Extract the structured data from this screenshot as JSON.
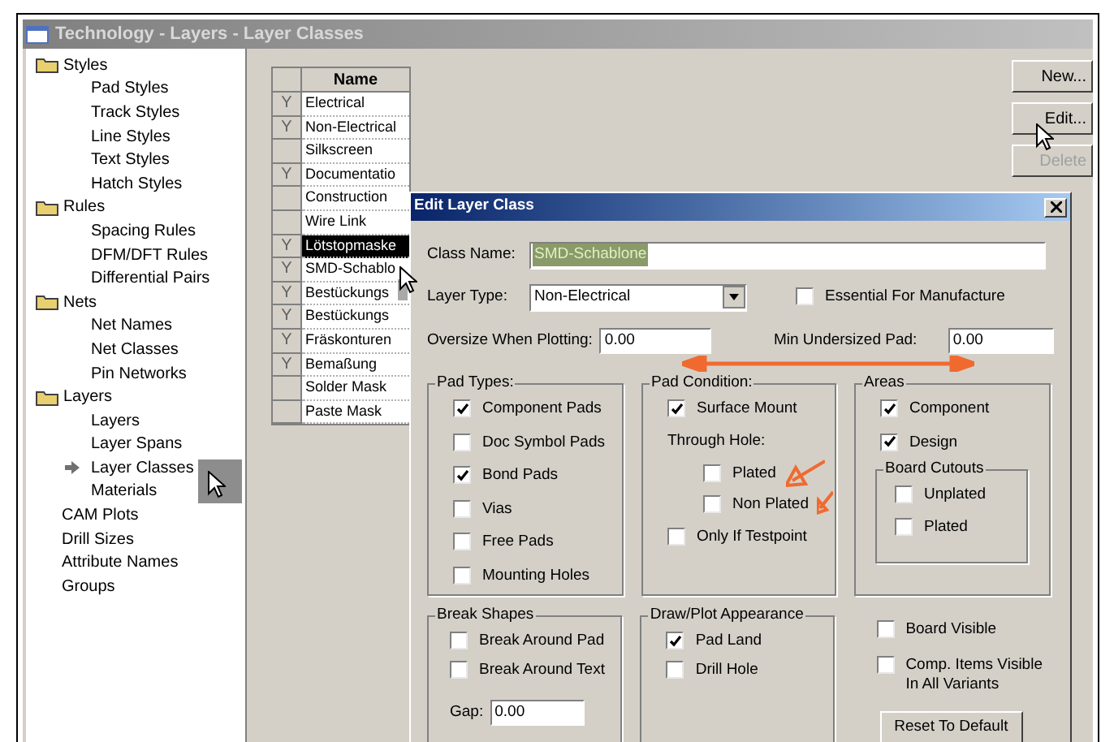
{
  "window": {
    "title": "Technology - Layers - Layer Classes"
  },
  "tree": [
    {
      "label": "Styles",
      "kind": "folder",
      "children": [
        {
          "label": "Pad Styles",
          "current": false
        },
        {
          "label": "Track Styles",
          "current": false
        },
        {
          "label": "Line Styles",
          "current": false
        },
        {
          "label": "Text Styles",
          "current": false
        },
        {
          "label": "Hatch Styles",
          "current": false
        }
      ]
    },
    {
      "label": "Rules",
      "kind": "folder",
      "children": [
        {
          "label": "Spacing Rules",
          "current": false
        },
        {
          "label": "DFM/DFT Rules",
          "current": false
        },
        {
          "label": "Differential Pairs",
          "current": false
        }
      ]
    },
    {
      "label": "Nets",
      "kind": "folder",
      "children": [
        {
          "label": "Net Names",
          "current": false
        },
        {
          "label": "Net Classes",
          "current": false
        },
        {
          "label": "Pin Networks",
          "current": false
        }
      ]
    },
    {
      "label": "Layers",
      "kind": "folder",
      "children": [
        {
          "label": "Layers",
          "current": false
        },
        {
          "label": "Layer Spans",
          "current": false
        },
        {
          "label": "Layer Classes",
          "current": true
        },
        {
          "label": "Materials",
          "current": false
        }
      ]
    },
    {
      "label": "CAM Plots",
      "kind": "item"
    },
    {
      "label": "Drill Sizes",
      "kind": "item"
    },
    {
      "label": "Attribute Names",
      "kind": "item"
    },
    {
      "label": "Groups",
      "kind": "item"
    }
  ],
  "table": {
    "columns": [
      "Name"
    ],
    "rows": [
      {
        "flag": "Y",
        "name": "Electrical",
        "selected": false
      },
      {
        "flag": "Y",
        "name": "Non-Electrical",
        "selected": false
      },
      {
        "name": "Silkscreen",
        "selected": false
      },
      {
        "flag": "Y",
        "name": "Documentatio",
        "selected": false
      },
      {
        "name": "Construction",
        "selected": false
      },
      {
        "name": "Wire Link",
        "selected": false
      },
      {
        "flag": "Y",
        "name": "Lötstopmaske",
        "selected": true
      },
      {
        "flag": "Y",
        "name": "SMD-Schablo",
        "selected": false
      },
      {
        "flag": "Y",
        "name": "Bestückungs",
        "selected": false
      },
      {
        "flag": "Y",
        "name": "Bestückungs",
        "selected": false
      },
      {
        "flag": "Y",
        "name": "Fräskonturen",
        "selected": false
      },
      {
        "flag": "Y",
        "name": "Bemaßung",
        "selected": false
      },
      {
        "name": "Solder Mask",
        "selected": false
      },
      {
        "name": "Paste Mask",
        "selected": false
      }
    ]
  },
  "buttons": [
    {
      "label": "New...",
      "disabled": false
    },
    {
      "label": "Edit...",
      "disabled": false
    },
    {
      "label": "Delete",
      "disabled": true
    }
  ],
  "dialog": {
    "title": "Edit Layer Class",
    "class_name": {
      "label": "Class Name:",
      "value": "SMD-Schablone"
    },
    "layer_type": {
      "label": "Layer Type:",
      "value": "Non-Electrical"
    },
    "essential": {
      "label": "Essential For Manufacture",
      "checked": false
    },
    "oversize": {
      "label": "Oversize When Plotting:",
      "value": "0.00"
    },
    "min_undersized": {
      "label": "Min Undersized Pad:",
      "value": "0.00"
    },
    "pad_types": {
      "title": "Pad Types:",
      "items": [
        {
          "label": "Component Pads",
          "checked": true
        },
        {
          "label": "Doc Symbol Pads",
          "checked": false
        },
        {
          "label": "Bond Pads",
          "checked": true
        },
        {
          "label": "Vias",
          "checked": false
        },
        {
          "label": "Free Pads",
          "checked": false
        },
        {
          "label": "Mounting Holes",
          "checked": false
        }
      ]
    },
    "pad_condition": {
      "title": "Pad Condition:",
      "surface_mount": {
        "label": "Surface Mount",
        "checked": true
      },
      "through_hole": "Through Hole:",
      "through_items": [
        {
          "label": "Plated",
          "checked": false
        },
        {
          "label": "Non Plated",
          "checked": false
        }
      ],
      "testpoint": {
        "label": "Only If Testpoint",
        "checked": false
      }
    },
    "areas": {
      "title": "Areas",
      "items": [
        {
          "label": "Component",
          "checked": true
        },
        {
          "label": "Design",
          "checked": true
        }
      ],
      "cutouts": {
        "title": "Board Cutouts",
        "items": [
          {
            "label": "Unplated",
            "checked": false
          },
          {
            "label": "Plated",
            "checked": false
          }
        ]
      }
    },
    "break_shapes": {
      "title": "Break Shapes",
      "items": [
        {
          "label": "Break Around Pad",
          "checked": false
        },
        {
          "label": "Break Around Text",
          "checked": false
        }
      ],
      "gap": {
        "label": "Gap:",
        "value": "0.00"
      }
    },
    "draw_plot": {
      "title": "Draw/Plot Appearance",
      "items": [
        {
          "label": "Pad Land",
          "checked": true
        },
        {
          "label": "Drill Hole",
          "checked": false
        }
      ]
    },
    "board_visible": {
      "label": "Board Visible",
      "checked": false
    },
    "comp_visible": {
      "label": "Comp. Items Visible In All Variants",
      "checked": false
    },
    "reset_button": "Reset To Default"
  }
}
